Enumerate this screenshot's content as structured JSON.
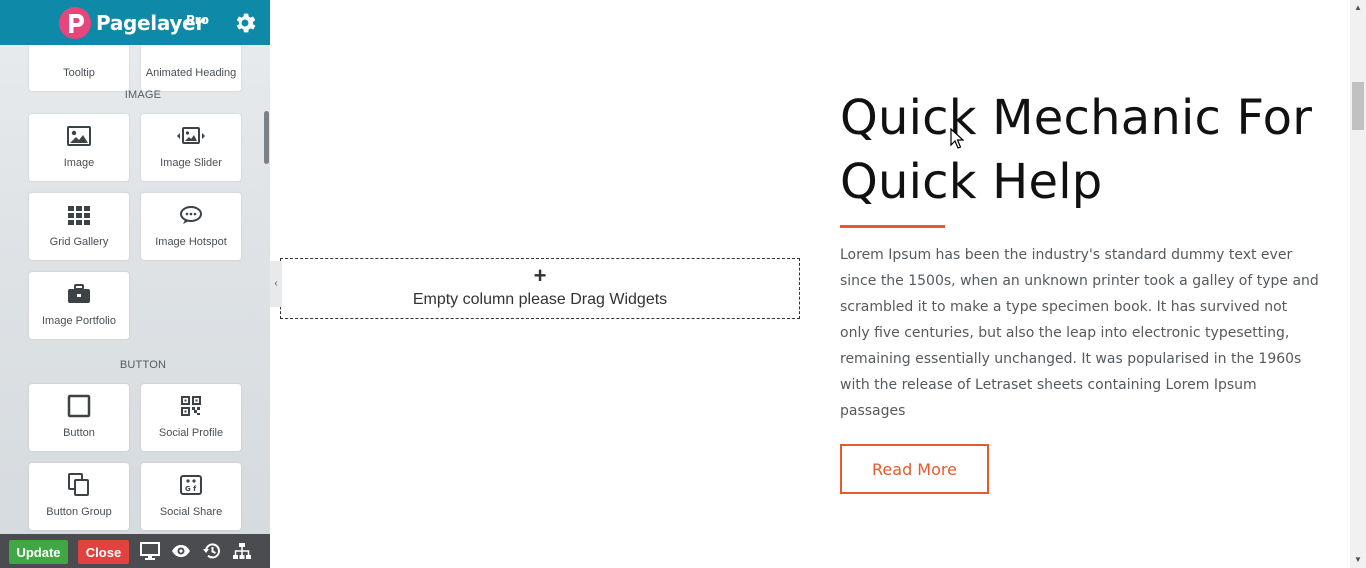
{
  "app": {
    "brand_name": "Pagelayer",
    "brand_tier": "Pro",
    "accent_color": "#0e8aa8"
  },
  "sidebar": {
    "partial_top_cards": [
      "Tooltip",
      "Animated Heading"
    ],
    "sections": [
      {
        "title": "IMAGE",
        "widgets": [
          {
            "label": "Image",
            "icon": "image-icon"
          },
          {
            "label": "Image Slider",
            "icon": "image-slider-icon"
          },
          {
            "label": "Grid Gallery",
            "icon": "grid-gallery-icon"
          },
          {
            "label": "Image Hotspot",
            "icon": "image-hotspot-icon"
          },
          {
            "label": "Image Portfolio",
            "icon": "briefcase-icon"
          }
        ]
      },
      {
        "title": "BUTTON",
        "widgets": [
          {
            "label": "Button",
            "icon": "button-square-icon"
          },
          {
            "label": "Social Profile",
            "icon": "qr-code-icon"
          },
          {
            "label": "Button Group",
            "icon": "copy-icon"
          },
          {
            "label": "Social Share",
            "icon": "social-share-icon"
          }
        ]
      }
    ]
  },
  "toolbar": {
    "update_label": "Update",
    "close_label": "Close",
    "icons": [
      "desktop-icon",
      "eye-icon",
      "history-icon",
      "sitemap-icon"
    ]
  },
  "canvas": {
    "drop_zone": {
      "plus": "+",
      "text": "Empty column please Drag Widgets"
    },
    "hero": {
      "title_line1": "Quick Mechanic For",
      "title_line2": "Quick Help",
      "body": "Lorem Ipsum has been the industry's standard dummy text ever since the 1500s, when an unknown printer took a galley of type and scrambled it to make a type specimen book. It has survived not only five centuries, but also the leap into electronic typesetting, remaining essentially unchanged. It was popularised in the 1960s with the release of Letraset sheets containing Lorem Ipsum passages",
      "button_label": "Read More",
      "accent_color": "#e75a2b"
    }
  }
}
